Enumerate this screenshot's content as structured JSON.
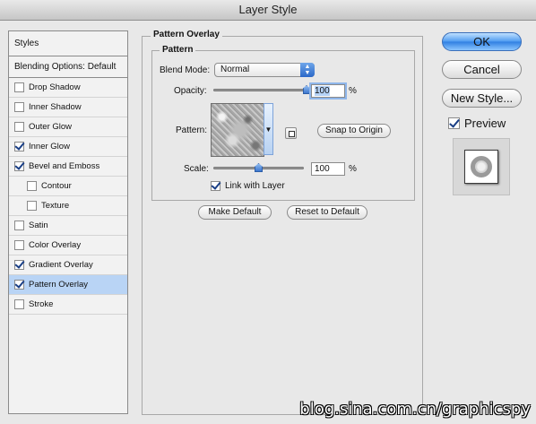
{
  "window": {
    "title": "Layer Style"
  },
  "styles_list": {
    "header": "Styles",
    "blending_options": "Blending Options: Default",
    "items": [
      {
        "label": "Drop Shadow",
        "checked": false,
        "sub": false,
        "selected": false
      },
      {
        "label": "Inner Shadow",
        "checked": false,
        "sub": false,
        "selected": false
      },
      {
        "label": "Outer Glow",
        "checked": false,
        "sub": false,
        "selected": false
      },
      {
        "label": "Inner Glow",
        "checked": true,
        "sub": false,
        "selected": false
      },
      {
        "label": "Bevel and Emboss",
        "checked": true,
        "sub": false,
        "selected": false
      },
      {
        "label": "Contour",
        "checked": false,
        "sub": true,
        "selected": false
      },
      {
        "label": "Texture",
        "checked": false,
        "sub": true,
        "selected": false
      },
      {
        "label": "Satin",
        "checked": false,
        "sub": false,
        "selected": false
      },
      {
        "label": "Color Overlay",
        "checked": false,
        "sub": false,
        "selected": false
      },
      {
        "label": "Gradient Overlay",
        "checked": true,
        "sub": false,
        "selected": false
      },
      {
        "label": "Pattern Overlay",
        "checked": true,
        "sub": false,
        "selected": true
      },
      {
        "label": "Stroke",
        "checked": false,
        "sub": false,
        "selected": false
      }
    ]
  },
  "panel": {
    "title": "Pattern Overlay",
    "group_title": "Pattern",
    "blend_mode_label": "Blend Mode:",
    "blend_mode_value": "Normal",
    "opacity_label": "Opacity:",
    "opacity_value": "100",
    "opacity_unit": "%",
    "opacity_fraction": 1.0,
    "pattern_label": "Pattern:",
    "snap_to_origin": "Snap to Origin",
    "scale_label": "Scale:",
    "scale_value": "100",
    "scale_unit": "%",
    "scale_fraction": 0.5,
    "link_with_layer": "Link with Layer",
    "link_with_layer_checked": true,
    "make_default": "Make Default",
    "reset_to_default": "Reset to Default"
  },
  "buttons": {
    "ok": "OK",
    "cancel": "Cancel",
    "new_style": "New Style..."
  },
  "preview": {
    "label": "Preview",
    "checked": true
  },
  "watermark": "blog.sina.com.cn/graphicspy",
  "colors": {
    "selection": "#b9d4f5",
    "accent": "#3d78cf"
  }
}
